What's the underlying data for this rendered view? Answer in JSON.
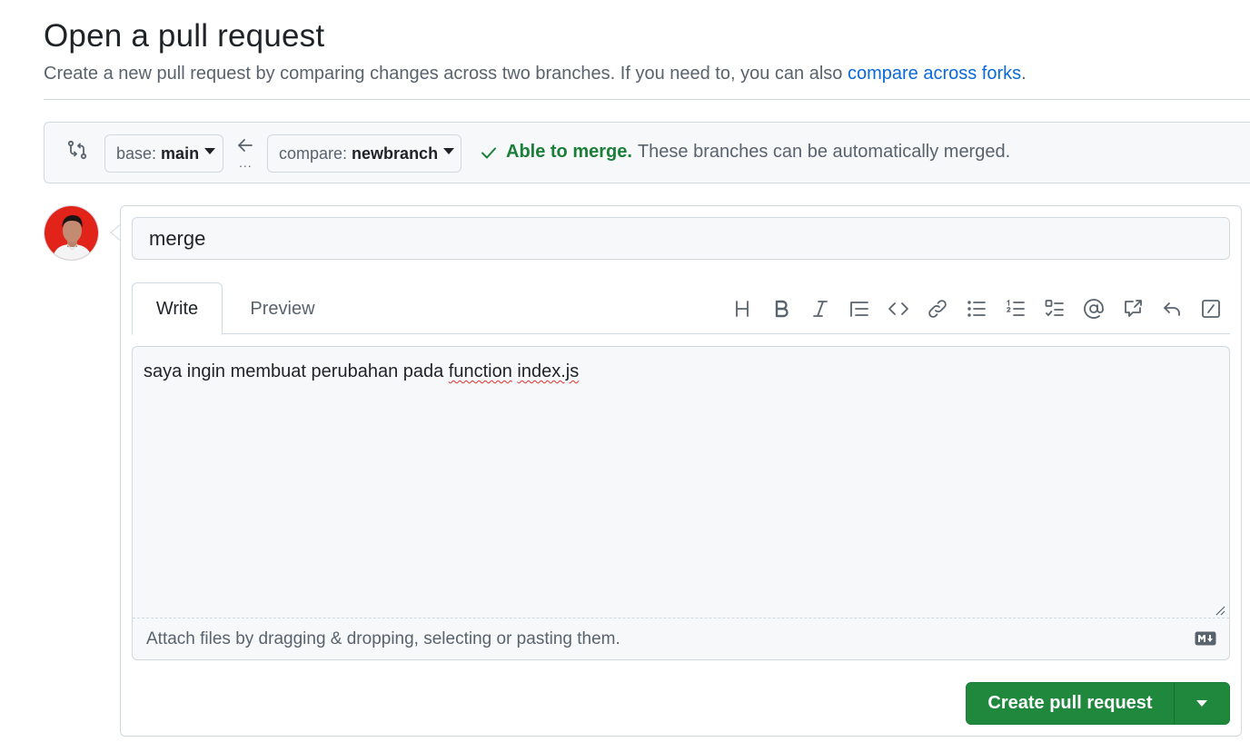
{
  "header": {
    "title": "Open a pull request",
    "subtitle": "Create a new pull request by comparing changes across two branches. If you need to, you can also ",
    "subtitle_link": "compare across forks",
    "subtitle_end": "."
  },
  "range": {
    "base_prefix": "base:",
    "base_branch": "main",
    "compare_prefix": "compare:",
    "compare_branch": "newbranch",
    "arrow_dots": "...",
    "merge_ok": "Able to merge.",
    "merge_detail": "These branches can be automatically merged."
  },
  "form": {
    "title_value": "merge",
    "tabs": {
      "write": "Write",
      "preview": "Preview"
    },
    "body_plain": "saya ingin membuat perubahan pada ",
    "body_word1": "function",
    "body_space": " ",
    "body_word2": "index.js",
    "attach_hint": "Attach files by dragging & dropping, selecting or pasting them.",
    "submit_label": "Create pull request"
  },
  "toolbar_icons": [
    "heading-icon",
    "bold-icon",
    "italic-icon",
    "quote-icon",
    "code-icon",
    "link-icon",
    "unordered-list-icon",
    "ordered-list-icon",
    "task-list-icon",
    "mention-icon",
    "cross-reference-icon",
    "reply-icon",
    "slash-command-icon"
  ],
  "colors": {
    "accent": "#0969da",
    "success": "#1a7f37",
    "submit": "#1f883d"
  }
}
